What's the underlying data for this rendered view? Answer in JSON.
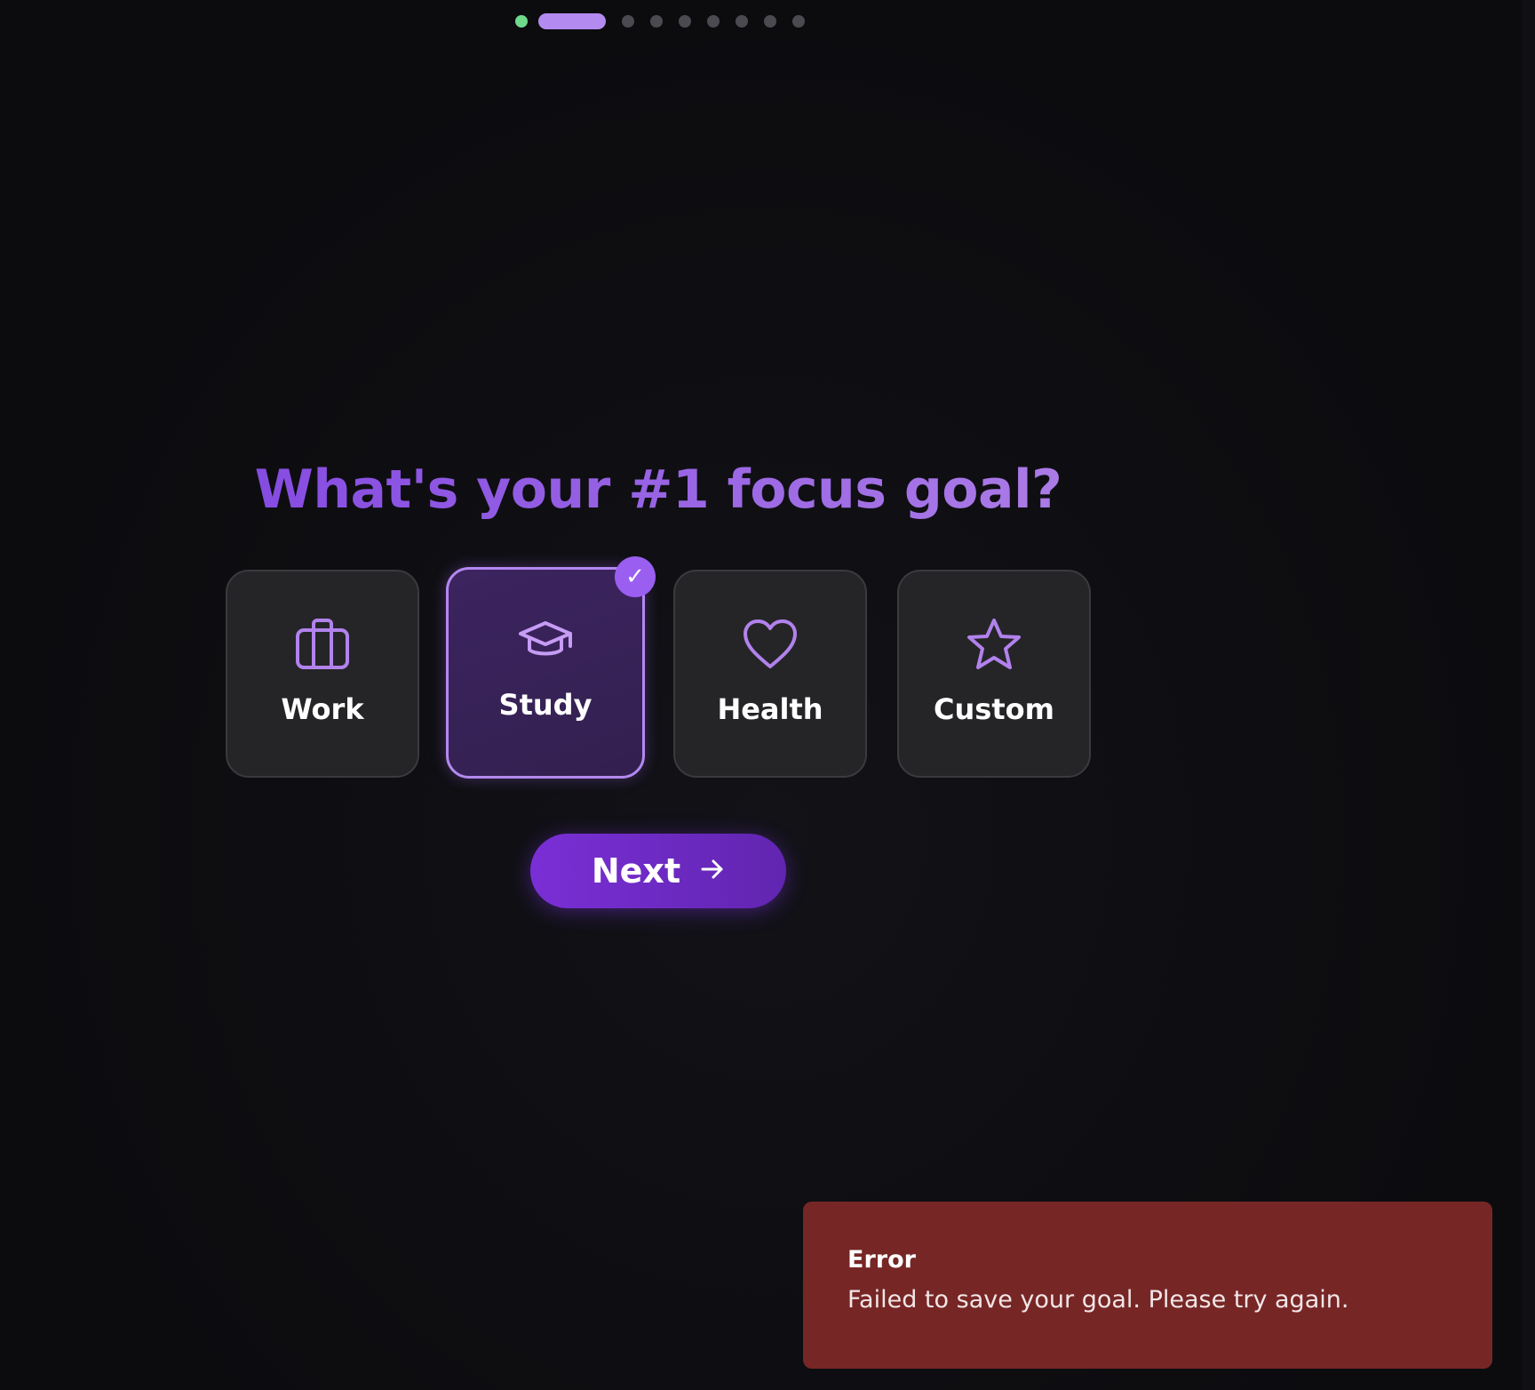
{
  "progress": {
    "total_steps": 10,
    "completed_steps": 1,
    "current_step": 2
  },
  "question": {
    "title": "What's your #1 focus goal?"
  },
  "options": [
    {
      "label": "Work",
      "icon": "briefcase-icon",
      "selected": false
    },
    {
      "label": "Study",
      "icon": "graduation-cap-icon",
      "selected": true
    },
    {
      "label": "Health",
      "icon": "heart-icon",
      "selected": false
    },
    {
      "label": "Custom",
      "icon": "star-icon",
      "selected": false
    }
  ],
  "selected_mark": "✓",
  "next_button": {
    "label": "Next",
    "icon": "arrow-right-icon"
  },
  "toast": {
    "title": "Error",
    "message": "Failed to save your goal. Please try again."
  },
  "colors": {
    "accent": "#9a5ef0",
    "done": "#6fd98c",
    "error": "#772626"
  }
}
